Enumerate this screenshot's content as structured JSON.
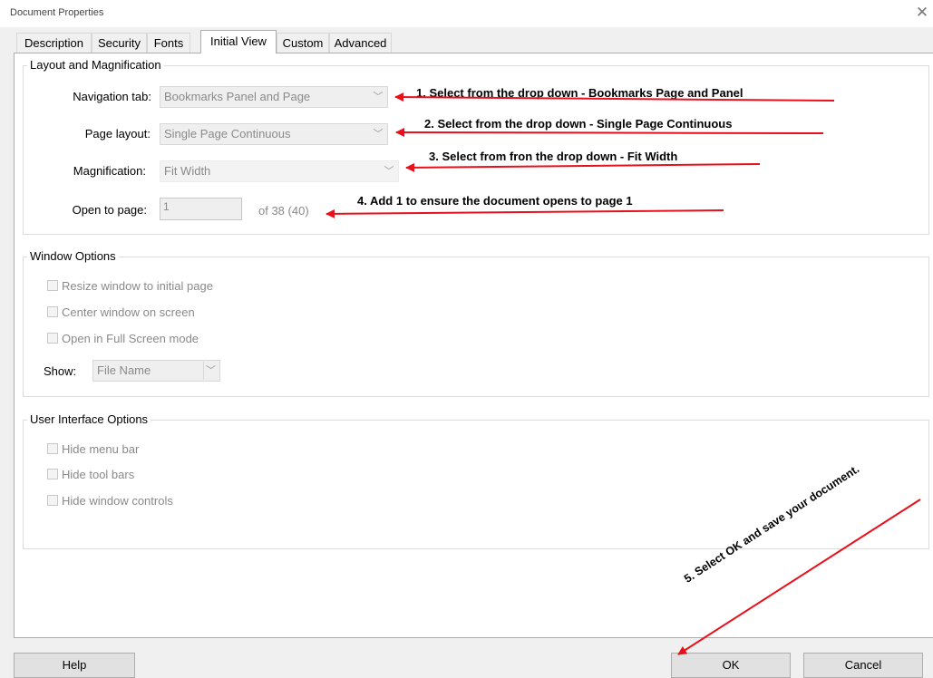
{
  "window": {
    "title": "Document Properties",
    "close_glyph": "✕"
  },
  "tabs": [
    {
      "label": "Description"
    },
    {
      "label": "Security"
    },
    {
      "label": "Fonts"
    },
    {
      "label": "Initial View",
      "active": true
    },
    {
      "label": "Custom"
    },
    {
      "label": "Advanced"
    }
  ],
  "layout_group": {
    "legend": "Layout and Magnification",
    "navigation_tab": {
      "label": "Navigation tab:",
      "value": "Bookmarks Panel and Page"
    },
    "page_layout": {
      "label": "Page layout:",
      "value": "Single Page Continuous"
    },
    "magnification": {
      "label": "Magnification:",
      "value": "Fit Width"
    },
    "open_to_page": {
      "label": "Open to page:",
      "value": "1",
      "of_text": "of 38 (40)"
    }
  },
  "window_group": {
    "legend": "Window Options",
    "checkboxes": [
      {
        "label": "Resize window to initial page"
      },
      {
        "label": "Center window on screen"
      },
      {
        "label": "Open in Full Screen mode"
      }
    ],
    "show": {
      "label": "Show:",
      "value": "File Name"
    }
  },
  "ui_group": {
    "legend": "User Interface Options",
    "checkboxes": [
      {
        "label": "Hide menu bar"
      },
      {
        "label": "Hide tool bars"
      },
      {
        "label": "Hide window controls"
      }
    ]
  },
  "buttons": {
    "help": "Help",
    "ok": "OK",
    "cancel": "Cancel"
  },
  "annotations": {
    "step1": "1. Select from the drop down - Bookmarks Page and Panel",
    "step2": "2. Select from the drop down -  Single Page Continuous",
    "step3": "3.  Select from fron the drop down - Fit Width",
    "step4": "4. Add 1 to ensure the document opens to page 1",
    "step5": "5. Select OK and save your document.",
    "arrow_color": "#e8101a"
  },
  "icons": {
    "dropdown": "chevron-down-icon",
    "close": "close-icon"
  }
}
